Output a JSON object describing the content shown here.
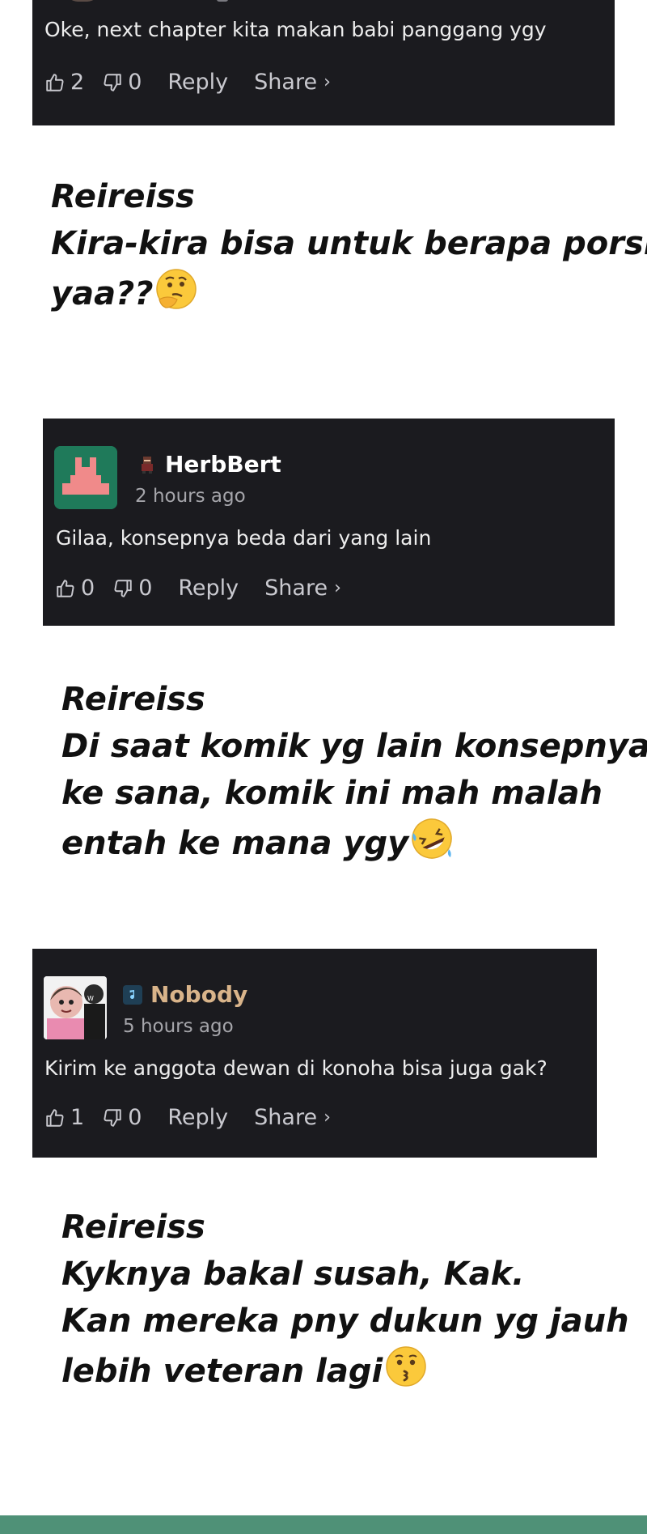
{
  "comments": [
    {
      "text": "Oke, next chapter kita makan babi panggang ygy",
      "likes": "2",
      "dislikes": "0",
      "reply_label": "Reply",
      "share_label": "Share",
      "share_chevron": "›"
    },
    {
      "username": "HerbBert",
      "timestamp": "2 hours ago",
      "text": "Gilaa, konsepnya beda dari yang lain",
      "likes": "0",
      "dislikes": "0",
      "reply_label": "Reply",
      "share_label": "Share",
      "share_chevron": "›",
      "username_color": "#ffffff"
    },
    {
      "username": "Nobody",
      "timestamp": "5 hours ago",
      "text": "Kirim ke anggota dewan di konoha bisa juga gak?",
      "likes": "1",
      "dislikes": "0",
      "reply_label": "Reply",
      "share_label": "Share",
      "share_chevron": "›",
      "username_color": "#d9b48a"
    }
  ],
  "replies": [
    {
      "author": "Reireiss",
      "lines": [
        "Kira-kira bisa untuk berapa porsi",
        "yaa??"
      ],
      "emoji": "thinking-face"
    },
    {
      "author": "Reireiss",
      "lines": [
        "Di saat komik yg lain konsepnya",
        "ke sana, komik ini mah malah",
        "entah ke mana ygy"
      ],
      "emoji": "rolling-laughing-face"
    },
    {
      "author": "Reireiss",
      "lines": [
        "Kyknya bakal susah, Kak.",
        " Kan mereka pny dukun yg jauh",
        " lebih veteran lagi"
      ],
      "emoji": "kissing-face"
    }
  ],
  "colors": {
    "card_bg": "#1b1b1f",
    "accent_green": "#4f9177",
    "herbbert_avatar_bg": "#1f7a5a",
    "herbbert_avatar_shape": "#f08a8a"
  }
}
